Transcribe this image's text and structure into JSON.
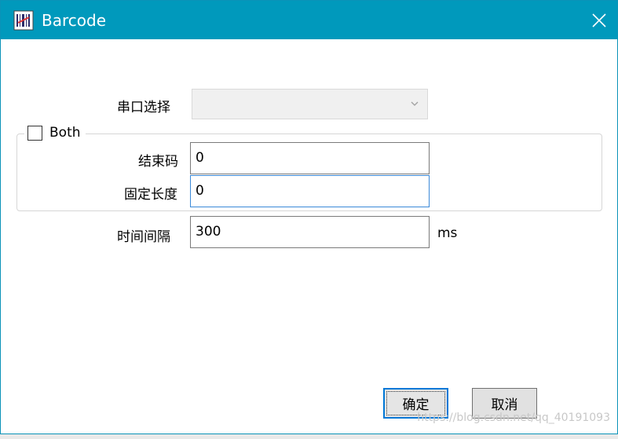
{
  "window": {
    "title": "Barcode",
    "icon": "barcode-app-icon",
    "close_icon": "close-icon"
  },
  "serial_port": {
    "label": "串口选择",
    "value": ""
  },
  "both_group": {
    "label": "Both",
    "checked": false
  },
  "end_code": {
    "label": "结束码",
    "value": "0"
  },
  "fixed_length": {
    "label": "固定长度",
    "value": "0"
  },
  "interval": {
    "label": "时间间隔",
    "value": "300",
    "unit": "ms"
  },
  "buttons": {
    "ok": "确定",
    "cancel": "取消"
  },
  "watermark": "https://blog.csdn.net/qq_40191093",
  "colors": {
    "titlebar": "#0099bc",
    "focus_border": "#3c8ad8",
    "default_button_border": "#0078d7"
  }
}
